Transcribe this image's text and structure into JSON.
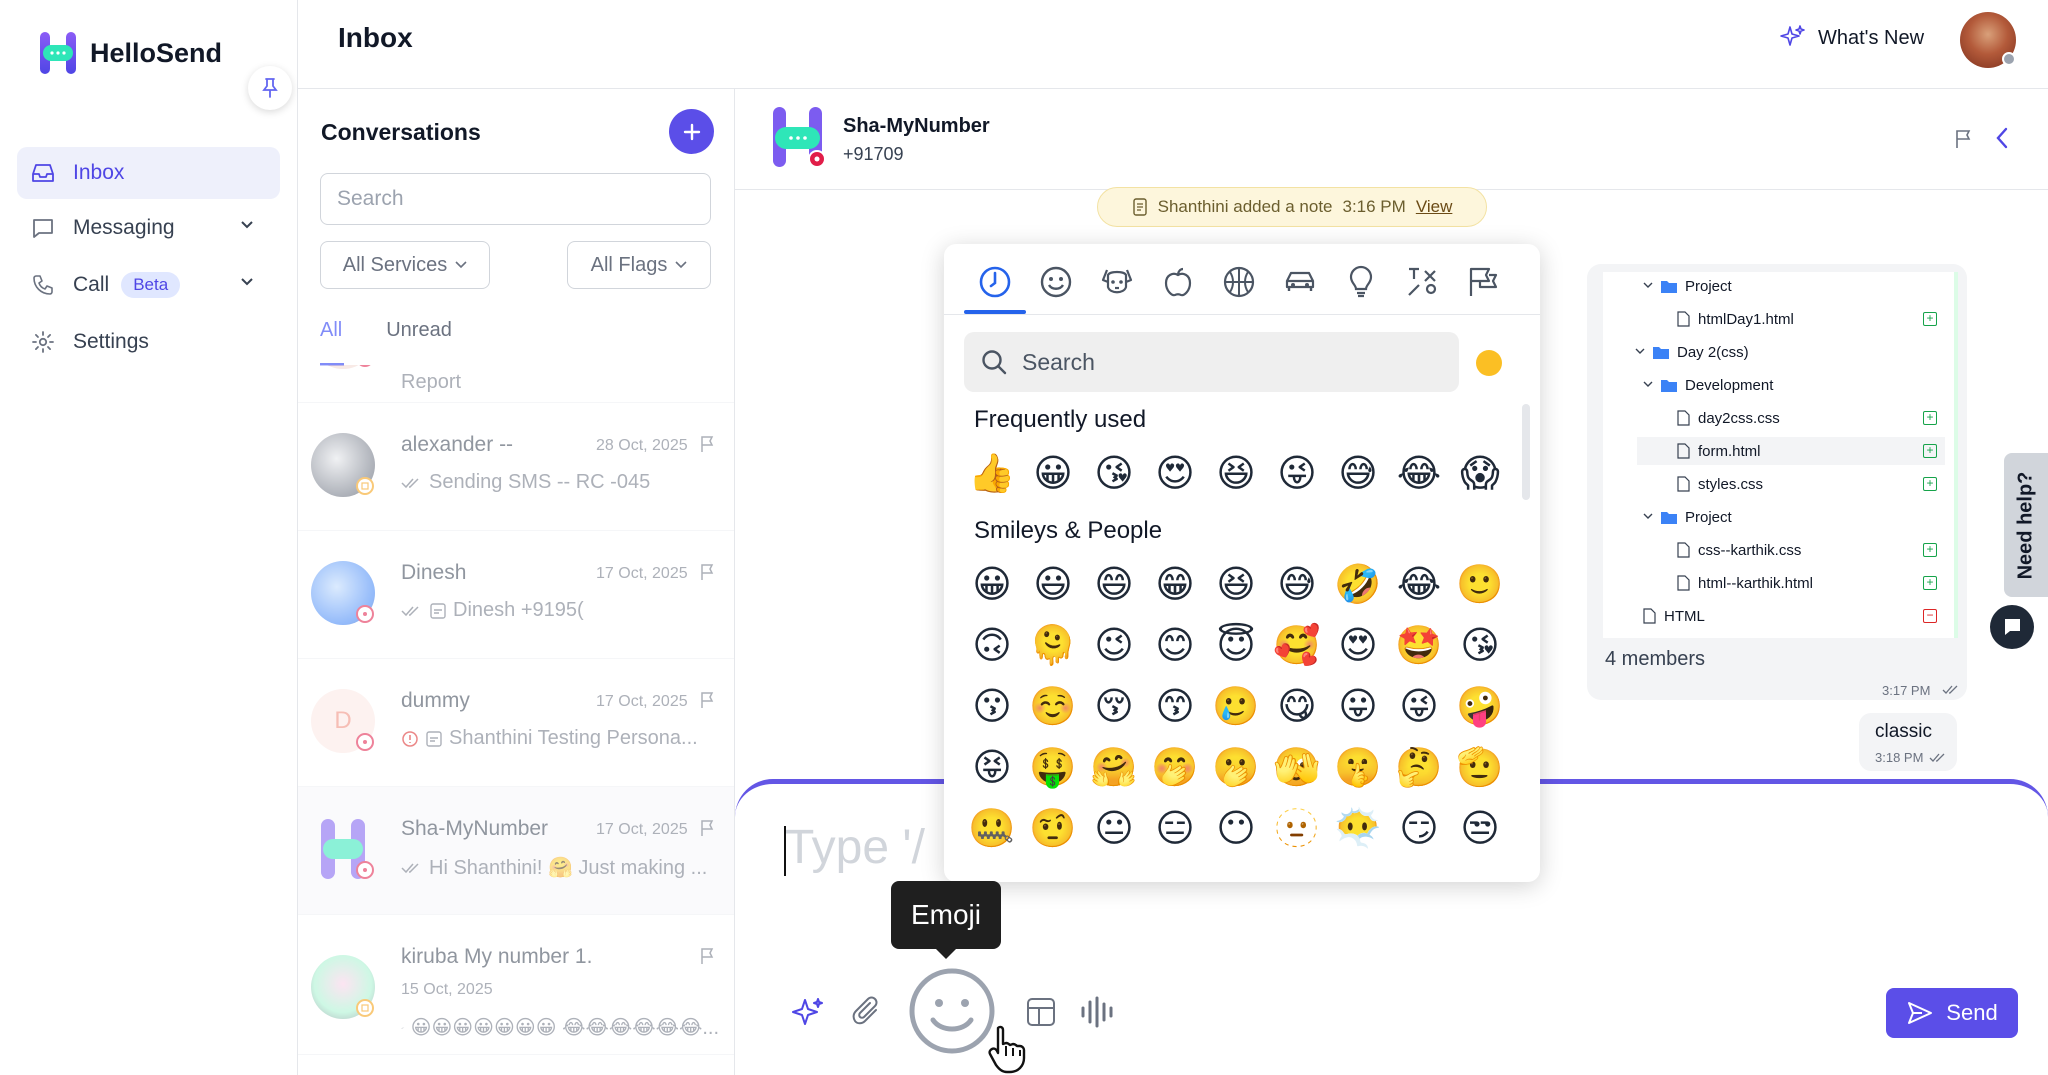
{
  "app": {
    "name": "HelloSend"
  },
  "sidebar": {
    "items": [
      {
        "label": "Inbox"
      },
      {
        "label": "Messaging"
      },
      {
        "label": "Call",
        "badge": "Beta"
      },
      {
        "label": "Settings"
      }
    ]
  },
  "header": {
    "title": "Inbox",
    "whats_new": "What's New"
  },
  "conversations": {
    "title": "Conversations",
    "search_placeholder": "Search",
    "filter_services": "All Services",
    "filter_flags": "All Flags",
    "tab_all": "All",
    "tab_unread": "Unread",
    "partial_preview": "Report",
    "items": [
      {
        "name": "alexander --",
        "date": "28 Oct, 2025",
        "preview": "Sending SMS -- RC -045"
      },
      {
        "name": "Dinesh",
        "date": "17 Oct, 2025",
        "preview": "Dinesh +9195("
      },
      {
        "name": "dummy",
        "initial": "D",
        "date": "17 Oct, 2025",
        "preview": "Shanthini Testing Persona..."
      },
      {
        "name": "Sha-MyNumber",
        "date": "17 Oct, 2025",
        "preview": "Hi Shanthini! 🤗 Just making ..."
      },
      {
        "name": "kiruba My number 1.",
        "date": "15 Oct, 2025",
        "preview": "😀😀😀😀😀😀😀 😂😂😂😂😂😂..."
      }
    ]
  },
  "chat": {
    "contact_name": "Sha-MyNumber",
    "contact_number": "+91709",
    "note": {
      "text": "Shanthini added a note",
      "time": "3:16 PM",
      "link": "View"
    },
    "file_tree": [
      {
        "label": "Project",
        "type": "folder"
      },
      {
        "label": "htmlDay1.html",
        "type": "file"
      },
      {
        "label": "Day 2(css)",
        "type": "folder"
      },
      {
        "label": "Development",
        "type": "folder"
      },
      {
        "label": "day2css.css",
        "type": "file"
      },
      {
        "label": "form.html",
        "type": "file"
      },
      {
        "label": "styles.css",
        "type": "file"
      },
      {
        "label": "Project",
        "type": "folder"
      },
      {
        "label": "css--karthik.css",
        "type": "file"
      },
      {
        "label": "html--karthik.html",
        "type": "file"
      },
      {
        "label": "HTML",
        "type": "file"
      }
    ],
    "members": "4 members",
    "file_msg_time": "3:17 PM",
    "classic_msg": {
      "text": "classic",
      "time": "3:18 PM"
    },
    "composer_placeholder": "Type '/",
    "send_label": "Send",
    "help_label": "Need help?"
  },
  "emoji_picker": {
    "search_placeholder": "Search",
    "section_frequent": "Frequently used",
    "section_smileys": "Smileys & People",
    "frequent": [
      "👍",
      "😀",
      "😘",
      "😍",
      "😆",
      "😜",
      "😅",
      "😂",
      "😱"
    ],
    "smileys": [
      [
        "😀",
        "😃",
        "😄",
        "😁",
        "😆",
        "😅",
        "🤣",
        "😂",
        "🙂"
      ],
      [
        "🙃",
        "🫠",
        "😉",
        "😊",
        "😇",
        "🥰",
        "😍",
        "🤩",
        "😘"
      ],
      [
        "😗",
        "☺️",
        "😚",
        "😙",
        "🥲",
        "😋",
        "😛",
        "😜",
        "🤪"
      ],
      [
        "😝",
        "🤑",
        "🤗",
        "🤭",
        "🫢",
        "🫣",
        "🤫",
        "🤔",
        "🫡"
      ],
      [
        "🤐",
        "🤨",
        "😐",
        "😑",
        "😶",
        "🫥",
        "😶‍🌫️",
        "😏",
        "😒"
      ]
    ]
  },
  "tooltip": {
    "label": "Emoji"
  },
  "colors": {
    "accent": "#5b4ee8",
    "active_nav_bg": "#eef0fb",
    "link": "#818cf8"
  }
}
